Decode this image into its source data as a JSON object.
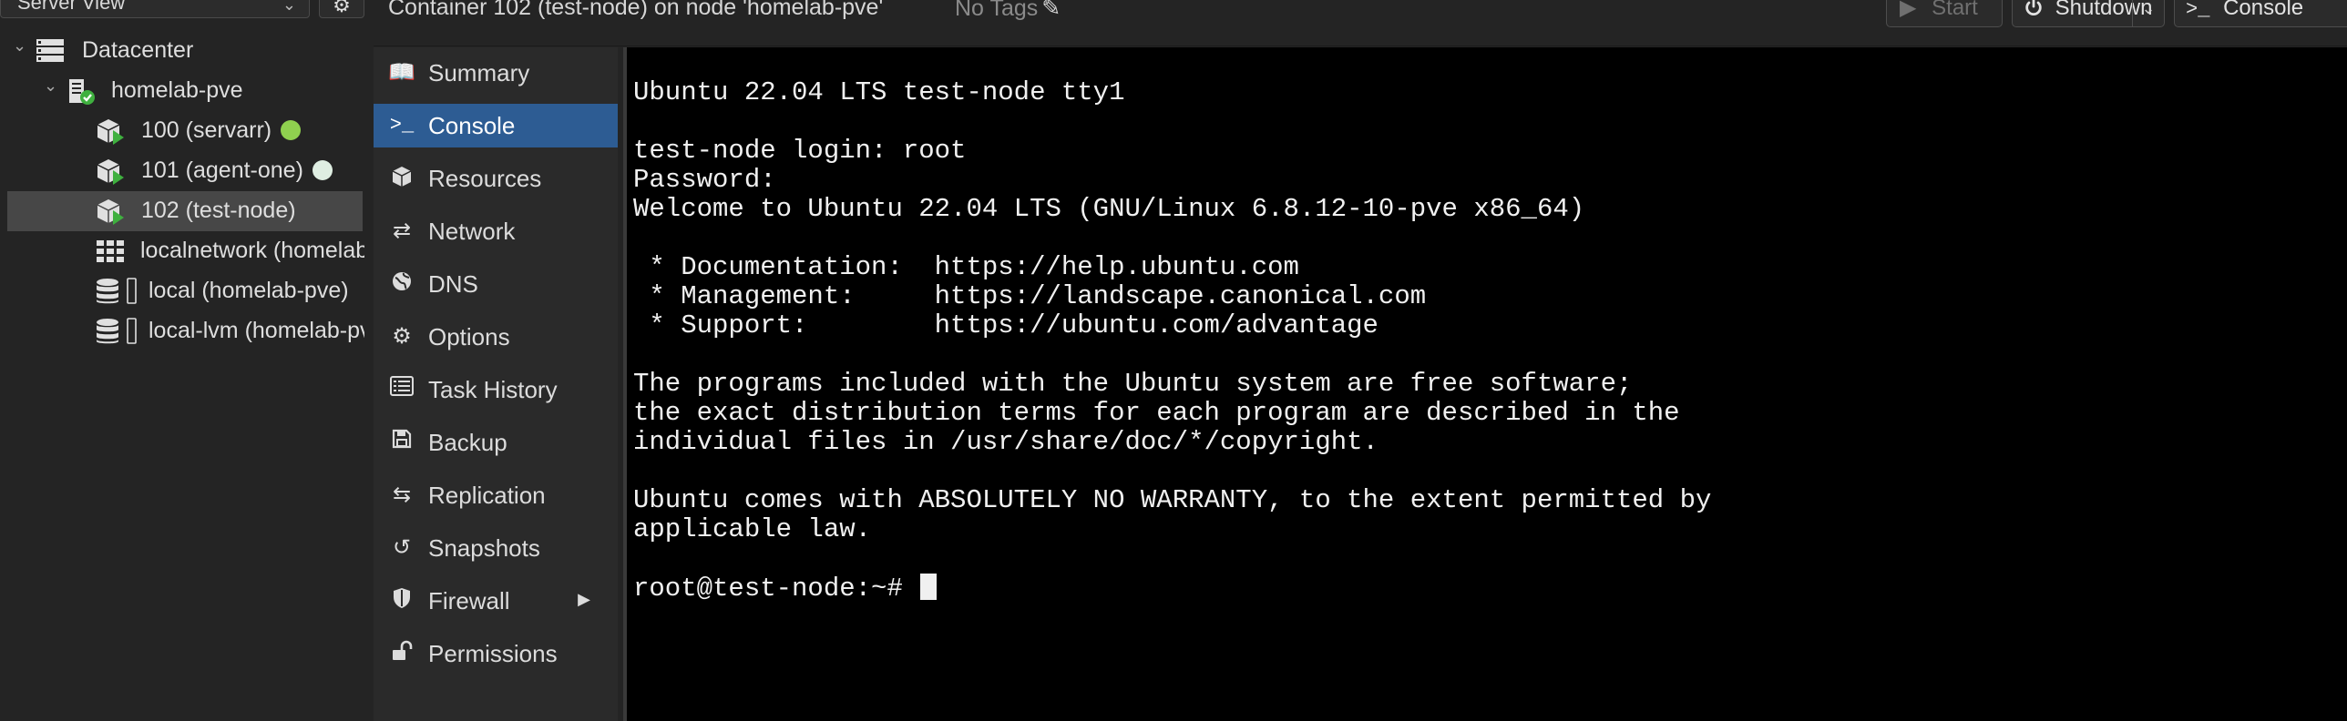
{
  "resource_view": {
    "label": "Server View"
  },
  "header": {
    "title": "Container 102 (test-node) on node 'homelab-pve'",
    "tags": "No Tags",
    "start_label": "Start",
    "shutdown_label": "Shutdown",
    "console_label": "Console"
  },
  "tree": {
    "datacenter": "Datacenter",
    "node": "homelab-pve",
    "containers": [
      {
        "label": "100 (servarr)",
        "status_color": "#8fd14f"
      },
      {
        "label": "101 (agent-one)",
        "status_color": "#dfeee2"
      },
      {
        "label": "102 (test-node)"
      }
    ],
    "network": "localnetwork (homelab-pve)",
    "storages": [
      {
        "label": "local (homelab-pve)"
      },
      {
        "label": "local-lvm (homelab-pve)"
      }
    ]
  },
  "nav": {
    "items": [
      {
        "label": "Summary",
        "icon": "book-icon"
      },
      {
        "label": "Console",
        "icon": "terminal-icon",
        "active": true
      },
      {
        "label": "Resources",
        "icon": "cube-icon"
      },
      {
        "label": "Network",
        "icon": "exchange-icon"
      },
      {
        "label": "DNS",
        "icon": "globe-icon"
      },
      {
        "label": "Options",
        "icon": "gear-icon"
      },
      {
        "label": "Task History",
        "icon": "list-icon"
      },
      {
        "label": "Backup",
        "icon": "floppy-icon"
      },
      {
        "label": "Replication",
        "icon": "retweet-icon"
      },
      {
        "label": "Snapshots",
        "icon": "history-icon"
      },
      {
        "label": "Firewall",
        "icon": "shield-icon"
      },
      {
        "label": "Permissions",
        "icon": "unlock-icon"
      }
    ]
  },
  "console": {
    "lines": [
      "Ubuntu 22.04 LTS test-node tty1",
      "",
      "test-node login: root",
      "Password:",
      "Welcome to Ubuntu 22.04 LTS (GNU/Linux 6.8.12-10-pve x86_64)",
      "",
      " * Documentation:  https://help.ubuntu.com",
      " * Management:     https://landscape.canonical.com",
      " * Support:        https://ubuntu.com/advantage",
      "",
      "The programs included with the Ubuntu system are free software;",
      "the exact distribution terms for each program are described in the",
      "individual files in /usr/share/doc/*/copyright.",
      "",
      "Ubuntu comes with ABSOLUTELY NO WARRANTY, to the extent permitted by",
      "applicable law.",
      ""
    ],
    "prompt": "root@test-node:~# "
  },
  "colors": {
    "accent": "#2d5c93",
    "running": "#3fb03f",
    "terminal_bg": "#000000"
  }
}
